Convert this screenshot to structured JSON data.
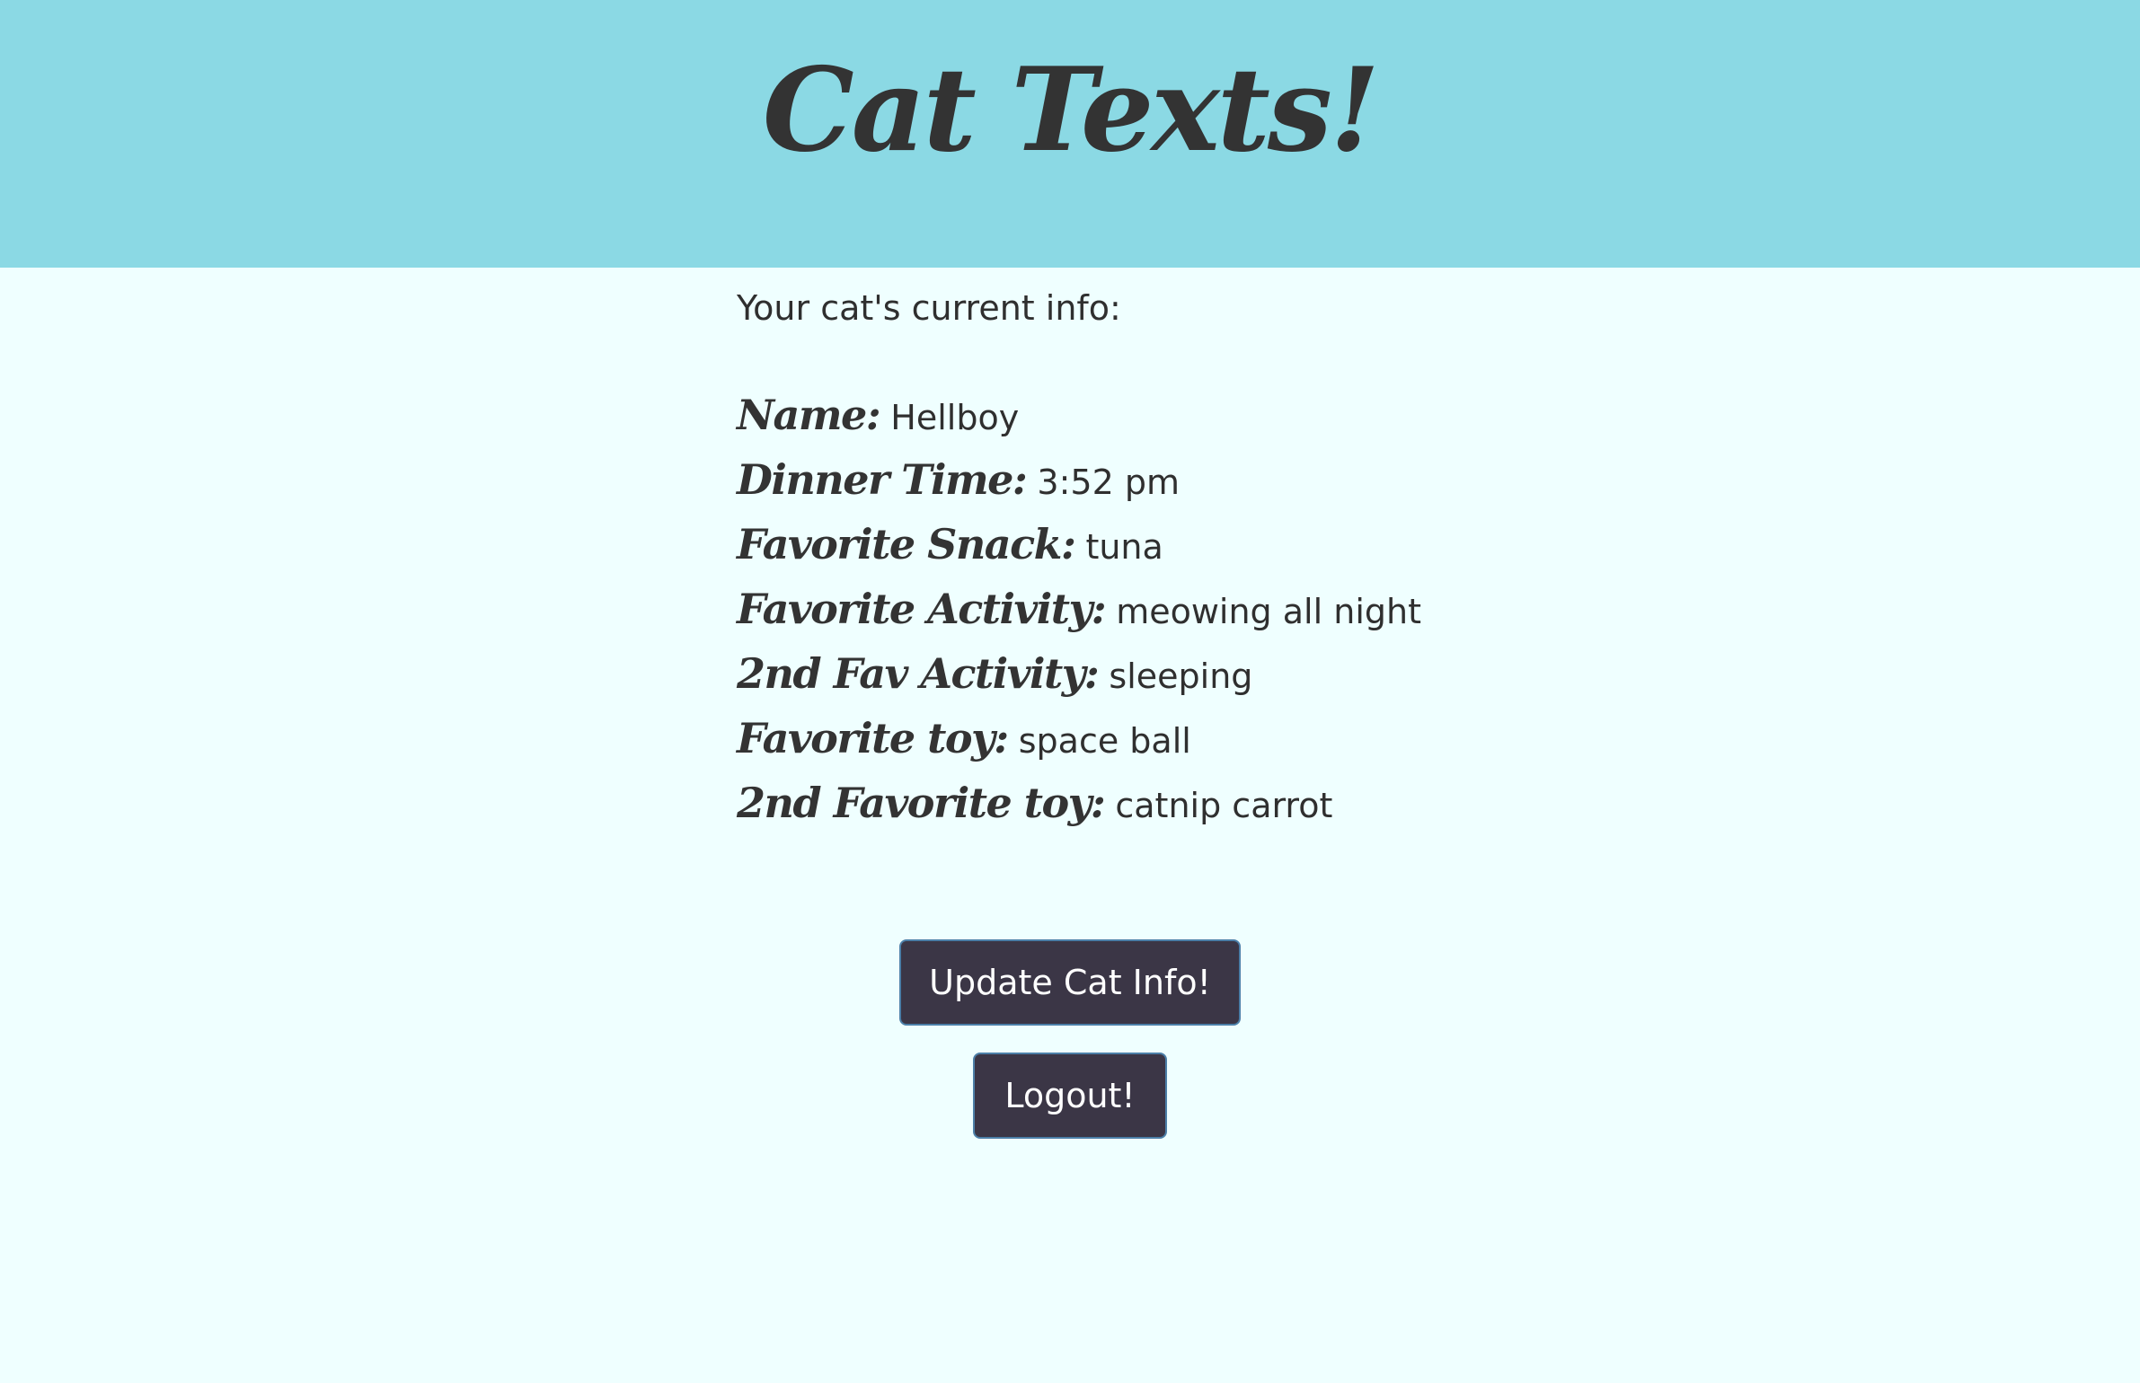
{
  "header": {
    "title": "Cat Texts!"
  },
  "main": {
    "intro": "Your cat's current info:",
    "info": [
      {
        "label": "Name:",
        "value": "Hellboy"
      },
      {
        "label": "Dinner Time:",
        "value": "3:52 pm"
      },
      {
        "label": "Favorite Snack:",
        "value": "tuna"
      },
      {
        "label": "Favorite Activity:",
        "value": "meowing all night"
      },
      {
        "label": "2nd Fav Activity:",
        "value": "sleeping"
      },
      {
        "label": "Favorite toy:",
        "value": "space ball"
      },
      {
        "label": "2nd Favorite toy:",
        "value": "catnip carrot"
      }
    ]
  },
  "buttons": {
    "update_label": "Update Cat Info!",
    "logout_label": "Logout!"
  },
  "colors": {
    "header_bg": "#8bd9e4",
    "page_bg": "#efffff",
    "button_bg": "#3b3646",
    "button_border": "#4c7fa8"
  }
}
